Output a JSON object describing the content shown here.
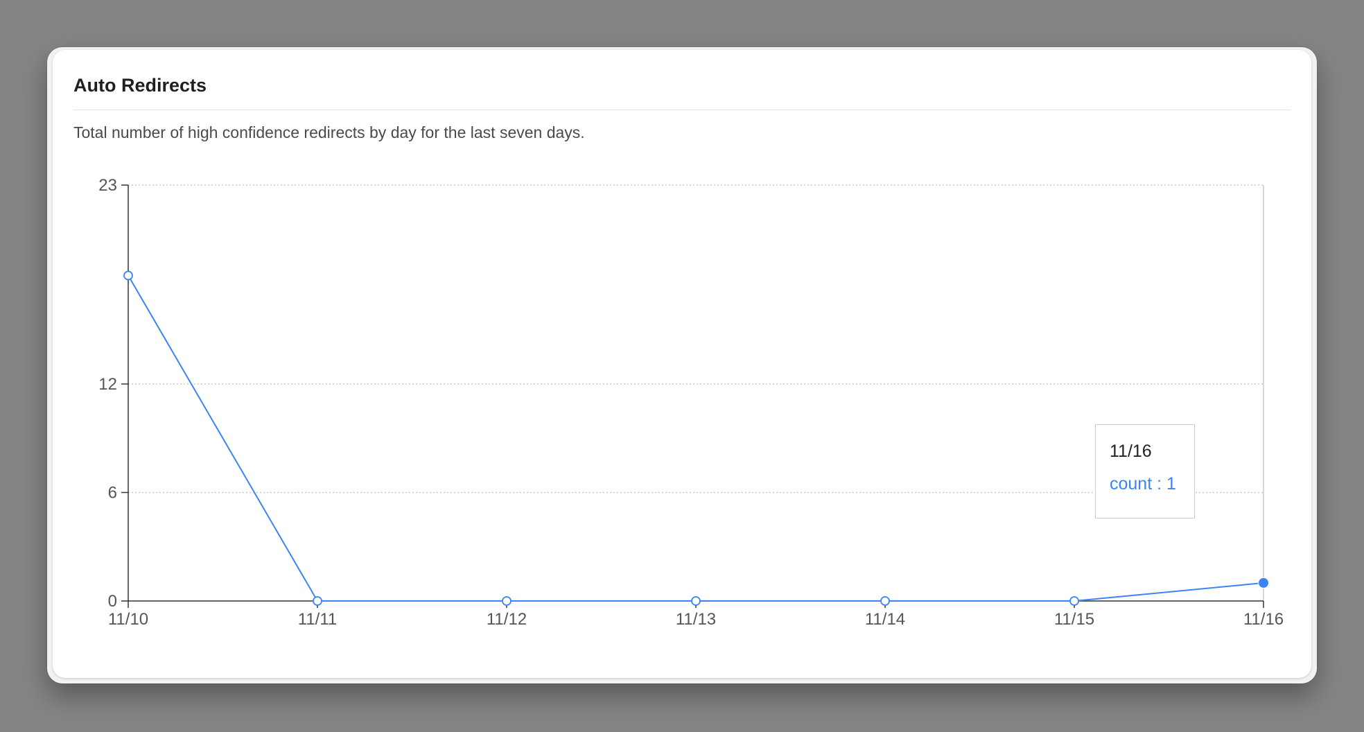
{
  "card": {
    "title": "Auto Redirects",
    "description": "Total number of high confidence redirects by day for the last seven days."
  },
  "tooltip": {
    "date": "11/16",
    "series_label": "count",
    "separator": " : ",
    "value": "1"
  },
  "colors": {
    "line": "#3a84f3",
    "axis": "#333333",
    "grid": "#c8c8c8",
    "background": "#858585"
  },
  "chart_data": {
    "type": "line",
    "title": "",
    "xlabel": "",
    "ylabel": "",
    "x": [
      "11/10",
      "11/11",
      "11/12",
      "11/13",
      "11/14",
      "11/15",
      "11/16"
    ],
    "series": [
      {
        "name": "count",
        "values": [
          18,
          0,
          0,
          0,
          0,
          0,
          1
        ]
      }
    ],
    "ylim": [
      0,
      23
    ],
    "yticks": [
      0,
      6,
      12,
      23
    ],
    "grid": "horizontal dotted",
    "highlighted_index": 6
  }
}
